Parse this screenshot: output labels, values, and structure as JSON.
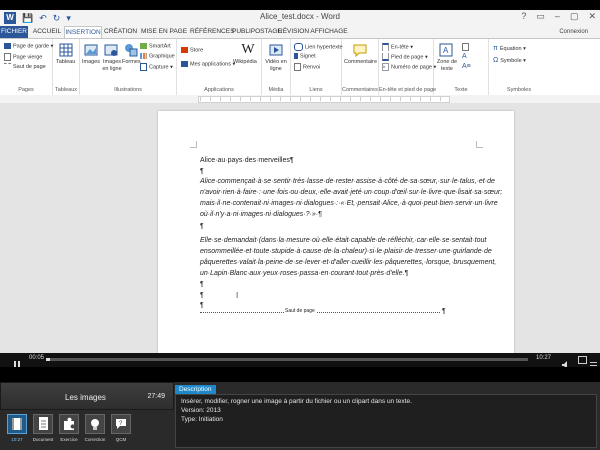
{
  "word": {
    "title": "Alice_test.docx - Word",
    "app_icon": "W",
    "window_controls": [
      "?",
      "▭",
      "–",
      "▢",
      "✕"
    ],
    "tabs": [
      "FICHIER",
      "ACCUEIL",
      "INSERTION",
      "CRÉATION",
      "MISE EN PAGE",
      "RÉFÉRENCES",
      "PUBLIPOSTAGE",
      "RÉVISION",
      "AFFICHAGE"
    ],
    "active_tab": "INSERTION",
    "account": "Connexion",
    "ribbon": {
      "pages": {
        "label": "Pages",
        "items": [
          "Page de garde ▾",
          "Page vierge",
          "Saut de page"
        ]
      },
      "tableaux": {
        "label": "Tableaux",
        "tableau": "Tableau"
      },
      "illustrations": {
        "label": "Illustrations",
        "images": "Images",
        "images_en_ligne": "Images en ligne",
        "formes": "Formes",
        "smartart": "SmartArt",
        "graphique": "Graphique",
        "capture": "Capture ▾"
      },
      "applications": {
        "label": "Applications",
        "store": "Store",
        "mes_applications": "Mes applications ▾",
        "wikipedia": "Wikipédia"
      },
      "media": {
        "label": "Média",
        "video": "Vidéo en ligne"
      },
      "liens": {
        "label": "Liens",
        "lien": "Lien hypertexte",
        "signet": "Signet",
        "renvoi": "Renvoi"
      },
      "commentaires": {
        "label": "Commentaires",
        "commentaire": "Commentaire"
      },
      "entete": {
        "label": "En-tête et pied de page",
        "entete": "En-tête ▾",
        "pied": "Pied de page ▾",
        "numero": "Numéro de page ▾"
      },
      "texte": {
        "label": "Texte",
        "zone": "Zone de texte"
      },
      "symboles": {
        "label": "Symboles",
        "equation": "Équation ▾",
        "symbole": "Symbole ▾"
      }
    },
    "document": {
      "heading": "Alice·au·pays·des·merveilles¶",
      "pilcrow": "¶",
      "para1": [
        "Alice·commençait·à·se·sentir·très·lasse·de·rester·assise·à·côté·de·sa·sœur,·sur·le·talus,·et·de",
        "n'avoir·rien·à·faire·:·une·fois·ou·deux,·elle·avait·jeté·un·coup·d'œil·sur·le·livre·que·lisait·sa·sœur;",
        "mais·il·ne·contenait·ni·images·ni·dialogues·:·«·Et,·pensait·Alice,·à·quoi·peut·bien·servir·un·livre",
        "où·il·n'y·a·ni·images·ni·dialogues·?·»·¶"
      ],
      "para2": [
        "Elle·se·demandait·(dans·la·mesure·où·elle·était·capable·de·réfléchir,·car·elle·se·sentait·tout",
        "ensommeillée·et·toute·stupide·à·cause·de·la·chaleur)·si·le·plaisir·de·tresser·une·guirlande·de",
        "pâquerettes·valait·la·peine·de·se·lever·et·d'aller·cueillir·les·pâquerettes,·lorsque,·brusquement,",
        "un·Lapin·Blanc·aux·yeux·roses·passa·en·courant·tout·près·d'elle.¶"
      ],
      "page_break": "Saut de page",
      "cursor": "I"
    }
  },
  "player": {
    "elapsed": "00:05",
    "duration": "10:27",
    "progress_fraction": 0.008
  },
  "lesson": {
    "title": "Les images",
    "duration": "27:49",
    "thumbs": [
      {
        "label": "10:27",
        "icon": "film-icon",
        "selected": true
      },
      {
        "label": "Document",
        "icon": "document-icon",
        "selected": false
      },
      {
        "label": "Exercice",
        "icon": "puzzle-icon",
        "selected": false
      },
      {
        "label": "Correction",
        "icon": "lightbulb-icon",
        "selected": false
      },
      {
        "label": "QCM",
        "icon": "quiz-icon",
        "selected": false
      }
    ]
  },
  "description": {
    "tab": "Description",
    "line1": "Insérer, modifier, rogner une image à partir du fichier ou un clipart dans un texte.",
    "line2": "Version: 2013",
    "line3": "Type: Initiation"
  },
  "colors": {
    "word_blue": "#2b579a",
    "accent": "#1e88c8"
  }
}
